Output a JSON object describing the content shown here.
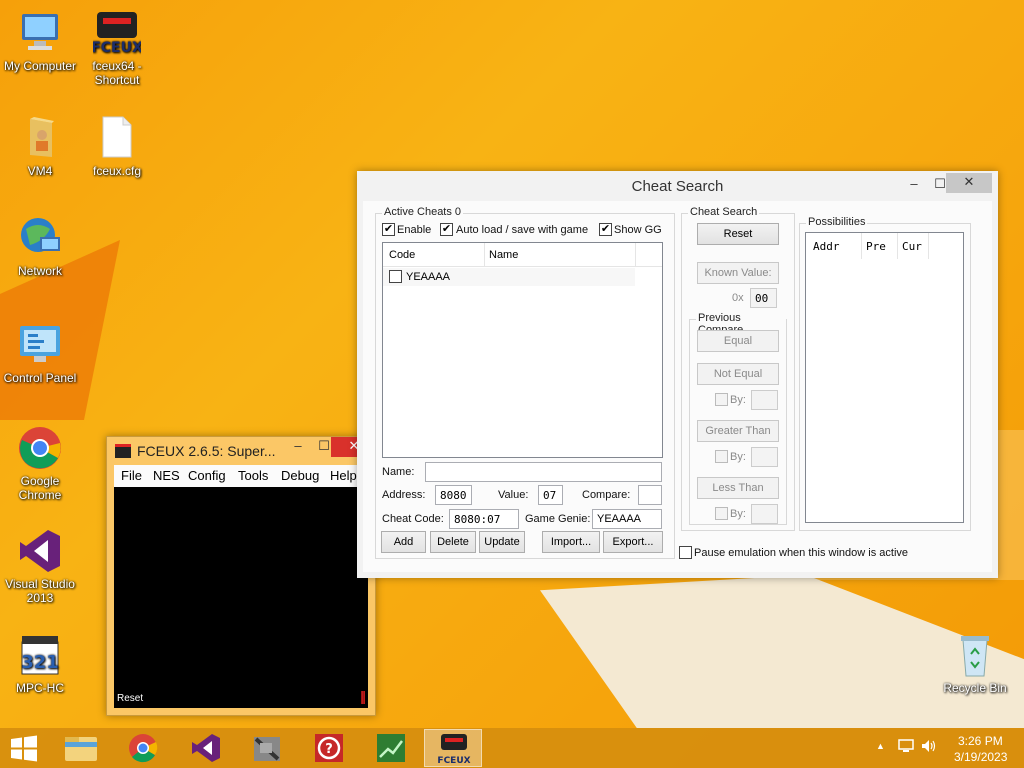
{
  "desktop": {
    "icons": [
      {
        "label": "My Computer"
      },
      {
        "label": "fceux64 - Shortcut"
      },
      {
        "label": "VM4"
      },
      {
        "label": "fceux.cfg"
      },
      {
        "label": "Network"
      },
      {
        "label": "Control Panel"
      },
      {
        "label": "Google Chrome"
      },
      {
        "label": "Visual Studio 2013"
      },
      {
        "label": "MPC-HC"
      },
      {
        "label": "Recycle Bin"
      }
    ]
  },
  "cheat_window": {
    "title": "Cheat Search",
    "minimize": "‒",
    "maximize": "☐",
    "close": "✕",
    "active_cheats": {
      "group_label": "Active Cheats 0",
      "enable_label": "Enable",
      "enable_checked": "✔",
      "autoload_label": "Auto load / save with game",
      "autoload_checked": "✔",
      "showgg_label": "Show GG",
      "showgg_checked": "✔",
      "columns": [
        "Code",
        "Name"
      ],
      "rows": [
        {
          "code": "",
          "name": "YEAAAA",
          "checked": ""
        }
      ],
      "name_label": "Name:",
      "name_value": "",
      "address_label": "Address:",
      "address_value": "8080",
      "value_label": "Value:",
      "value_value": "07",
      "compare_label": "Compare:",
      "compare_value": "",
      "cheat_code_label": "Cheat Code:",
      "cheat_code_value": "8080:07",
      "game_genie_label": "Game Genie:",
      "game_genie_value": "YEAAAA",
      "add": "Add",
      "delete": "Delete",
      "update": "Update",
      "import": "Import...",
      "export": "Export..."
    },
    "cheat_search": {
      "group_label": "Cheat Search",
      "reset": "Reset",
      "known_value": "Known Value:",
      "hex_prefix": "0x",
      "known_field": "00",
      "previous_compare": "Previous Compare",
      "equal": "Equal",
      "not_equal": "Not Equal",
      "greater_than": "Greater Than",
      "less_than": "Less Than",
      "by_label": "By:"
    },
    "possibilities": {
      "group_label": "Possibilities",
      "columns": [
        "Addr",
        "Pre",
        "Cur"
      ]
    },
    "pause_label": "Pause emulation when this window is active"
  },
  "fceux_window": {
    "title": "FCEUX 2.6.5: Super...",
    "minimize": "‒",
    "maximize": "☐",
    "close": "✕",
    "menu": [
      "File",
      "NES",
      "Config",
      "Tools",
      "Debug",
      "Help"
    ],
    "status": "Reset",
    "pause_indicator": "||"
  },
  "taskbar": {
    "apps": [
      "windows-start",
      "file-explorer",
      "google-chrome",
      "visual-studio",
      "ini-editor",
      "help",
      "resource-monitor",
      "fceux"
    ],
    "time": "3:26 PM",
    "date": "3/19/2023"
  },
  "icons": {
    "app_icon_fceux": "fceux-icon",
    "color_accent": "#f7a90f"
  }
}
